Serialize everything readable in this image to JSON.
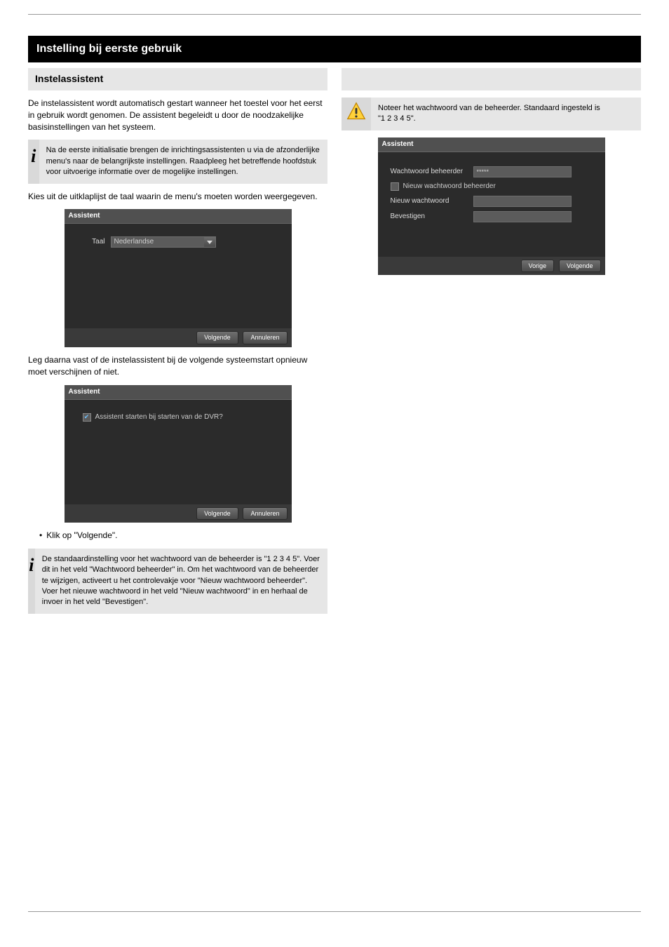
{
  "section": {
    "title": "Instelling bij eerste gebruik"
  },
  "left": {
    "subhead": "Instelassistent",
    "para1": "De instelassistent wordt automatisch gestart wanneer het toestel voor het eerst in gebruik wordt genomen. De assistent begeleidt u door de noodzakelijke basisinstellingen van het systeem.",
    "note1": "Na de eerste initialisatie brengen de inrichtingsassistenten u via de afzonderlijke menu's naar de belangrijkste instellingen. Raadpleeg het betreffende hoofdstuk voor uitvoerige informatie over de mogelijke instellingen.",
    "para2": "Kies uit de uitklaplijst de taal waarin de menu's moeten worden weergegeven.",
    "dialog1": {
      "title": "Assistent",
      "taal_label": "Taal",
      "language_value": "Nederlandse",
      "btn_next": "Volgende",
      "btn_cancel": "Annuleren"
    },
    "para3": "Leg daarna vast of de instelassistent bij de volgende systeemstart opnieuw moet verschijnen of niet.",
    "dialog2": {
      "title": "Assistent",
      "check_label": "Assistent starten bij starten van de DVR?",
      "btn_next": "Volgende",
      "btn_cancel": "Annuleren"
    },
    "bullet1": "Klik op \"Volgende\".",
    "note2": "De standaardinstelling voor het wachtwoord van de beheerder is \"1 2 3 4 5\". Voer dit in het veld \"Wachtwoord beheerder\" in. Om het wachtwoord van de beheerder te wijzigen, activeert u het controlevakje voor \"Nieuw wachtwoord beheerder\". Voer het nieuwe wachtwoord in het veld \"Nieuw wachtwoord\" in en herhaal de invoer in het veld \"Bevestigen\"."
  },
  "right": {
    "warn_text": "Noteer het wachtwoord van de beheerder. Standaard ingesteld is",
    "warn_code": "\"1 2 3 4 5\".",
    "dialog3": {
      "title": "Assistent",
      "lbl_admin_pw": "Wachtwoord beheerder",
      "admin_pw_value": "*****",
      "chk_new_pw": "Nieuw wachtwoord beheerder",
      "lbl_new_pw": "Nieuw wachtwoord",
      "lbl_confirm": "Bevestigen",
      "btn_prev": "Vorige",
      "btn_next": "Volgende"
    }
  },
  "footer": {
    "left": "",
    "right": ""
  }
}
